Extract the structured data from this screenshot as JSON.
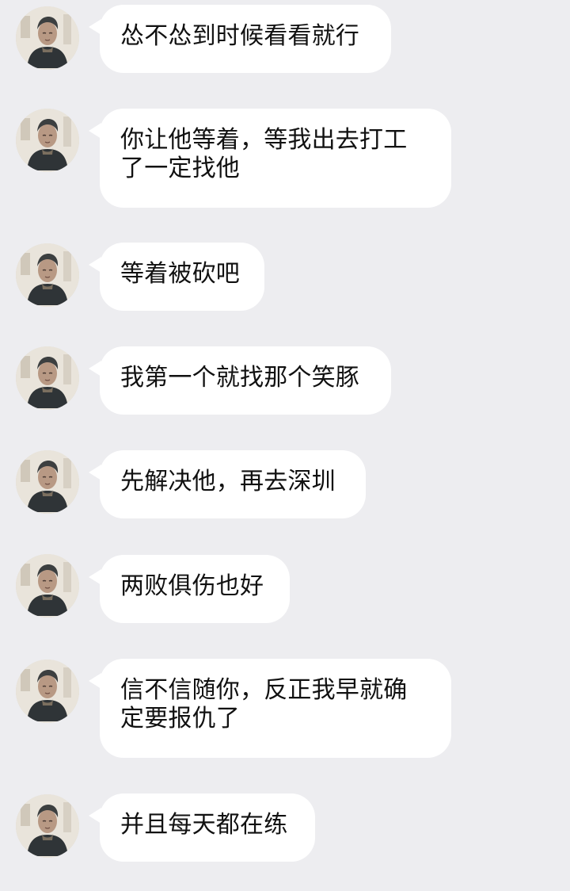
{
  "messages": [
    {
      "text": "怂不怂到时候看看就行"
    },
    {
      "text": "你让他等着，等我出去打工了一定找他"
    },
    {
      "text": "等着被砍吧"
    },
    {
      "text": "我第一个就找那个笑豚"
    },
    {
      "text": "先解决他，再去深圳"
    },
    {
      "text": "两败俱伤也好"
    },
    {
      "text": "信不信随你，反正我早就确定要报仇了"
    },
    {
      "text": "并且每天都在练"
    }
  ]
}
